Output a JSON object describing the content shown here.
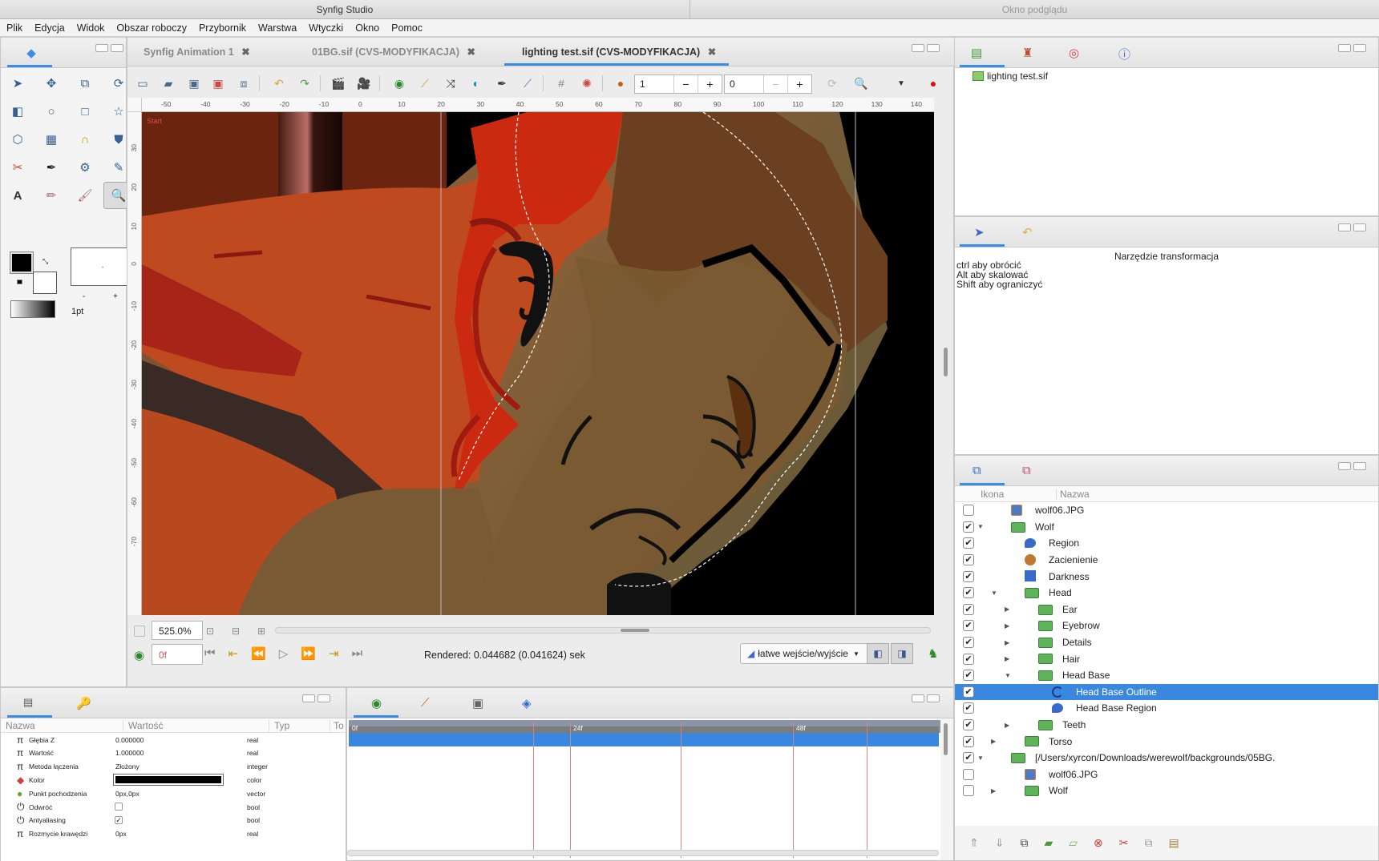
{
  "app": {
    "title": "Synfig Studio",
    "preview_title": "Okno podglądu"
  },
  "menu": [
    "Plik",
    "Edycja",
    "Widok",
    "Obszar roboczy",
    "Przybornik",
    "Warstwa",
    "Wtyczki",
    "Okno",
    "Pomoc"
  ],
  "doc_tabs": [
    {
      "label": "Synfig Animation 1"
    },
    {
      "label": "01BG.sif (CVS-MODYFIKACJA)"
    },
    {
      "label": "lighting test.sif (CVS-MODYFIKACJA)"
    }
  ],
  "canvas_toolbar": {
    "spin1": "1",
    "spin2": "0",
    "minus": "−",
    "plus": "+"
  },
  "ruler": {
    "h_ticks": [
      "-50",
      "-40",
      "-30",
      "-20",
      "-10",
      "0",
      "10",
      "20",
      "30",
      "40",
      "50",
      "60",
      "70",
      "80",
      "90",
      "100",
      "110",
      "120",
      "130",
      "140"
    ],
    "v_ticks": [
      "30",
      "20",
      "10",
      "0",
      "-10",
      "-20",
      "-30",
      "-40",
      "-50",
      "-60",
      "-70"
    ]
  },
  "canvas": {
    "corner_label": "Start"
  },
  "zoom": "525.0%",
  "frame_field": "0f",
  "render_status": "Rendered: 0.044682 (0.041624) sek",
  "interp": "łatwe wejście/wyjście",
  "toolbox": {
    "width_label": "1pt",
    "minus": "-",
    "plus": "+"
  },
  "canvas_browser": {
    "file": "lighting test.sif"
  },
  "tool_options": {
    "title": "Narzędzie transformacja",
    "lines": [
      "ctrl aby obrócić",
      "Alt aby skalować",
      "Shift aby ograniczyć"
    ]
  },
  "layers": {
    "headers": [
      "Ikona",
      "Nazwa"
    ],
    "rows": [
      {
        "name": "wolf06.JPG",
        "checked": false,
        "indent": 0,
        "icon": "image",
        "expander": ""
      },
      {
        "name": "Wolf",
        "checked": true,
        "indent": 0,
        "icon": "folder",
        "expander": "▼"
      },
      {
        "name": "Region",
        "checked": true,
        "indent": 1,
        "icon": "region",
        "expander": ""
      },
      {
        "name": "Zacienienie",
        "checked": true,
        "indent": 1,
        "icon": "shade",
        "expander": ""
      },
      {
        "name": "Darkness",
        "checked": true,
        "indent": 1,
        "icon": "rect",
        "expander": ""
      },
      {
        "name": "Head",
        "checked": true,
        "indent": 1,
        "icon": "folder",
        "expander": "▼"
      },
      {
        "name": "Ear",
        "checked": true,
        "indent": 2,
        "icon": "folder",
        "expander": "▶"
      },
      {
        "name": "Eyebrow",
        "checked": true,
        "indent": 2,
        "icon": "folder",
        "expander": "▶"
      },
      {
        "name": "Details",
        "checked": true,
        "indent": 2,
        "icon": "folder",
        "expander": "▶"
      },
      {
        "name": "Hair",
        "checked": true,
        "indent": 2,
        "icon": "folder",
        "expander": "▶"
      },
      {
        "name": "Head Base",
        "checked": true,
        "indent": 2,
        "icon": "folder",
        "expander": "▼"
      },
      {
        "name": "Head Base Outline",
        "checked": true,
        "indent": 3,
        "icon": "outline",
        "expander": "",
        "selected": true
      },
      {
        "name": "Head Base Region",
        "checked": true,
        "indent": 3,
        "icon": "region",
        "expander": ""
      },
      {
        "name": "Teeth",
        "checked": true,
        "indent": 2,
        "icon": "folder",
        "expander": "▶"
      },
      {
        "name": "Torso",
        "checked": true,
        "indent": 1,
        "icon": "folder",
        "expander": "▶"
      },
      {
        "name": "[/Users/xyrcon/Downloads/werewolf/backgrounds/05BG.",
        "checked": true,
        "indent": 0,
        "icon": "folder",
        "expander": "▼"
      },
      {
        "name": "wolf06.JPG",
        "checked": false,
        "indent": 1,
        "icon": "image",
        "expander": ""
      },
      {
        "name": "Wolf",
        "checked": false,
        "indent": 1,
        "icon": "folder",
        "expander": "▶"
      }
    ]
  },
  "params": {
    "headers": [
      "Nazwa",
      "Wartość",
      "Typ",
      "To"
    ],
    "rows": [
      {
        "name": "Głębia Z",
        "value": "0.000000",
        "type": "real",
        "icon": "pi"
      },
      {
        "name": "Wartość",
        "value": "1.000000",
        "type": "real",
        "icon": "pi"
      },
      {
        "name": "Metoda łączenia",
        "value": "Złożony",
        "type": "integer",
        "icon": "pi"
      },
      {
        "name": "Kolor",
        "value": "",
        "type": "color",
        "icon": "color"
      },
      {
        "name": "Punkt pochodzenia",
        "value": "0px,0px",
        "type": "vector",
        "icon": "dot"
      },
      {
        "name": "Odwróć",
        "value": "",
        "type": "bool",
        "icon": "power"
      },
      {
        "name": "Antyaliasing",
        "value": "✓",
        "type": "bool",
        "icon": "power"
      },
      {
        "name": "Rozmycie krawędzi",
        "value": "0px",
        "type": "real",
        "icon": "pi"
      }
    ]
  },
  "timetrack": {
    "labels": [
      "0f",
      "24f",
      "48f"
    ]
  },
  "colors": {
    "accent": "#3a8ee6",
    "selection": "#3a87e0",
    "fill": "#000000",
    "outline_color": "#000000"
  }
}
